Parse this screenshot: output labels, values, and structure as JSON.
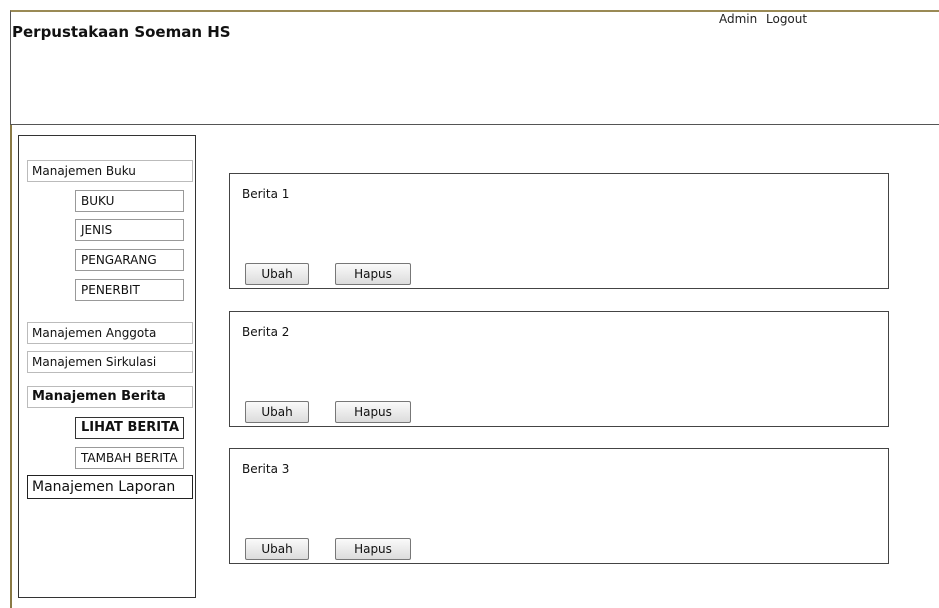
{
  "header": {
    "title": "Perpustakaan Soeman HS",
    "user_label": "Admin",
    "logout_label": "Logout"
  },
  "sidebar": {
    "buku": {
      "label": "Manajemen Buku",
      "items": [
        "BUKU",
        "JENIS",
        "PENGARANG",
        "PENERBIT"
      ]
    },
    "anggota": "Manajemen Anggota",
    "sirkulasi": "Manajemen Sirkulasi",
    "berita": {
      "label": "Manajemen Berita",
      "items": [
        "LIHAT BERITA",
        "TAMBAH BERITA"
      ]
    },
    "laporan": "Manajemen Laporan"
  },
  "news": [
    {
      "title": "Berita 1",
      "edit_label": "Ubah",
      "delete_label": "Hapus"
    },
    {
      "title": "Berita 2",
      "edit_label": "Ubah",
      "delete_label": "Hapus"
    },
    {
      "title": "Berita 3",
      "edit_label": "Ubah",
      "delete_label": "Hapus"
    }
  ]
}
